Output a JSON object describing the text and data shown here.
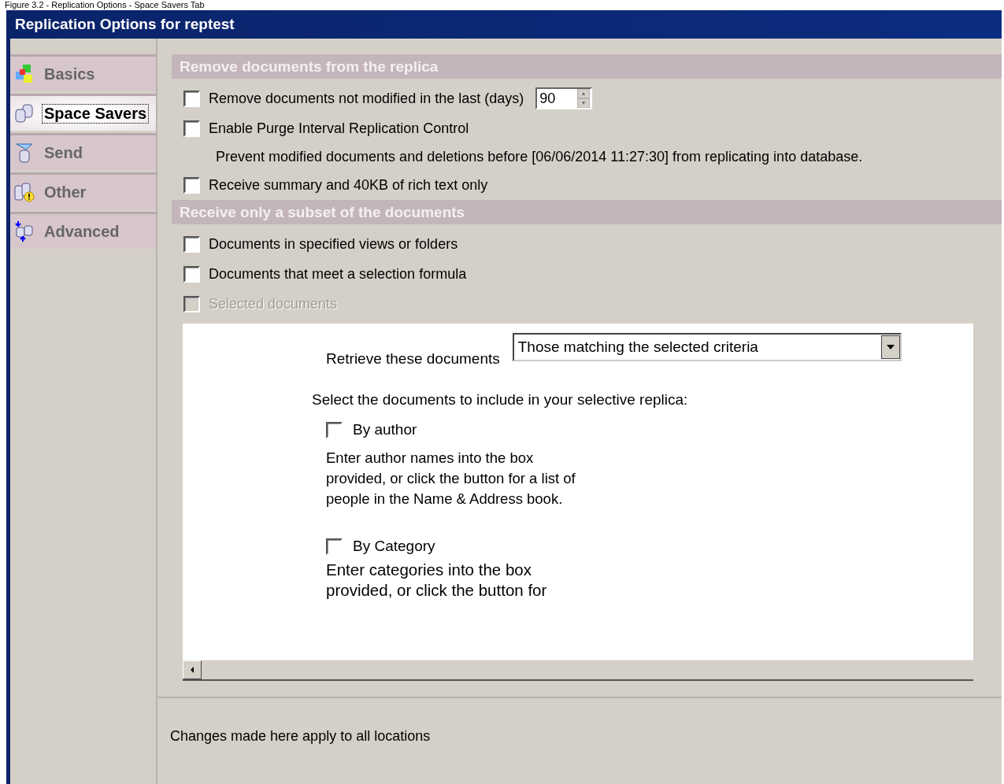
{
  "caption": "Figure 3.2 - Replication Options - Space Savers Tab",
  "window": {
    "title": "Replication Options for reptest"
  },
  "sidebar": {
    "items": [
      {
        "label": "Basics",
        "kind": "blocks",
        "selected": false
      },
      {
        "label": "Space Savers",
        "kind": "disks",
        "selected": true
      },
      {
        "label": "Send",
        "kind": "funnel",
        "selected": false
      },
      {
        "label": "Other",
        "kind": "warning",
        "selected": false
      },
      {
        "label": "Advanced",
        "kind": "arrows",
        "selected": false
      }
    ]
  },
  "sections": [
    {
      "title": "Remove documents from the replica",
      "items": [
        {
          "kind": "checkbox",
          "label": "Remove documents not modified in the last (days)",
          "checked": false,
          "disabled": false,
          "spin_value": "90"
        },
        {
          "kind": "checkbox",
          "label": "Enable Purge Interval Replication Control",
          "checked": false,
          "disabled": false
        },
        {
          "kind": "note",
          "label": "Prevent modified documents and deletions before [06/06/2014 11:27:30] from replicating into database."
        },
        {
          "kind": "checkbox",
          "label": "Receive summary and 40KB of rich text only",
          "checked": false,
          "disabled": false
        }
      ]
    },
    {
      "title": "Receive only a subset of the documents",
      "items": [
        {
          "kind": "checkbox",
          "label": "Documents in specified views or folders",
          "checked": false,
          "disabled": false
        },
        {
          "kind": "checkbox",
          "label": "Documents that meet a selection formula",
          "checked": false,
          "disabled": false
        },
        {
          "kind": "checkbox",
          "label": "Selected documents",
          "checked": false,
          "disabled": true
        }
      ]
    }
  ],
  "selective_panel": {
    "retrieve_label": "Retrieve these documents",
    "retrieve_value": "Those matching the selected criteria",
    "instruction": "Select the documents to include in your selective replica:",
    "criteria": [
      {
        "label": "By author",
        "checked": false,
        "description": "Enter author names into the box provided, or click the button for a list of people in the Name & Address book."
      },
      {
        "label": "By Category",
        "checked": false,
        "description": "Enter categories into the box provided, or click the button for"
      }
    ]
  },
  "footer": "Changes made here apply to all locations"
}
